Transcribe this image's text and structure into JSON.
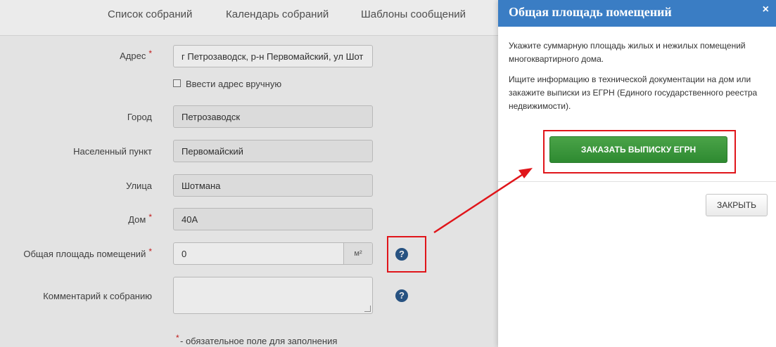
{
  "nav": {
    "items": [
      "Список собраний",
      "Календарь собраний",
      "Шаблоны сообщений"
    ]
  },
  "form": {
    "address_label": "Адрес",
    "address_value": "г Петрозаводск, р-н Первомайский, ул Шот",
    "manual_address_label": "Ввести адрес вручную",
    "city_label": "Город",
    "city_value": "Петрозаводск",
    "settlement_label": "Населенный пункт",
    "settlement_value": "Первомайский",
    "street_label": "Улица",
    "street_value": "Шотмана",
    "house_label": "Дом",
    "house_value": "40А",
    "area_label": "Общая площадь помещений",
    "area_value": "0",
    "area_unit": "м²",
    "comment_label": "Комментарий к собранию",
    "required_mark": "*",
    "required_note": "- обязательное поле для заполнения"
  },
  "modal": {
    "title": "Общая площадь помещений",
    "close_symbol": "×",
    "text1": "Укажите суммарную площадь жилых и нежилых помещений многоквартирного дома.",
    "text2": "Ищите информацию в технической документации на дом или закажите выписки из ЕГРН (Единого государственного реестра недвижимости).",
    "order_button": "ЗАКАЗАТЬ ВЫПИСКУ ЕГРН",
    "close_button": "ЗАКРЫТЬ"
  },
  "icons": {
    "help": "help-icon",
    "help_symbol": "?"
  },
  "colors": {
    "modal_header": "#3a7dc4",
    "order_button": "#3b9a3c",
    "highlight": "#e0151a",
    "required": "#d21f1f"
  }
}
